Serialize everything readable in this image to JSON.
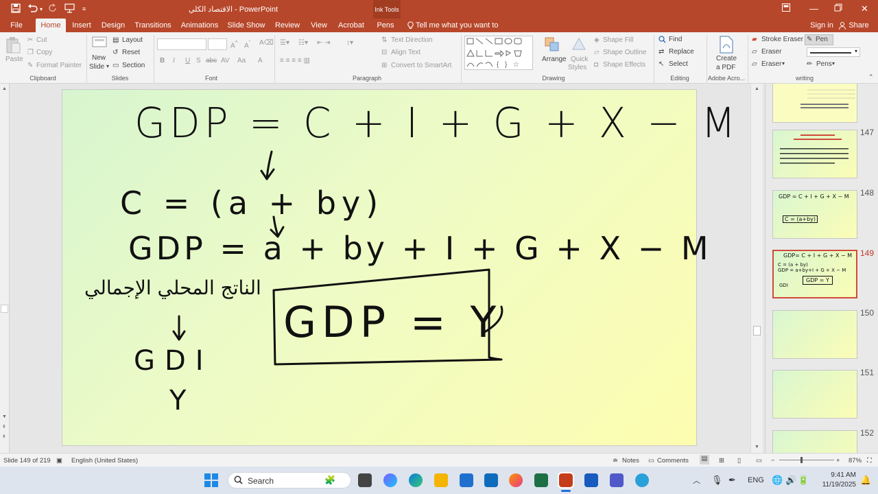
{
  "titlebar": {
    "title": "الاقتصاد الكلي - PowerPoint",
    "context_tab": "Ink Tools"
  },
  "tabs": [
    "File",
    "Home",
    "Insert",
    "Design",
    "Transitions",
    "Animations",
    "Slide Show",
    "Review",
    "View",
    "Acrobat",
    "Pens"
  ],
  "tell_me": "Tell me what you want to do...",
  "account": {
    "signin": "Sign in",
    "share": "Share"
  },
  "ribbon": {
    "clipboard": {
      "paste": "Paste",
      "cut": "Cut",
      "copy": "Copy",
      "format_painter": "Format Painter",
      "label": "Clipboard"
    },
    "slides": {
      "new_slide_1": "New",
      "new_slide_2": "Slide",
      "layout": "Layout",
      "reset": "Reset",
      "section": "Section",
      "label": "Slides"
    },
    "font": {
      "label": "Font",
      "bold": "B",
      "italic": "I",
      "underline": "U",
      "strike": "S",
      "abc": "abc",
      "av": "AV",
      "aa": "Aa",
      "a": "A"
    },
    "paragraph": {
      "text_direction": "Text Direction",
      "align_text": "Align Text",
      "convert_smartart": "Convert to SmartArt",
      "label": "Paragraph"
    },
    "drawing": {
      "arrange": "Arrange",
      "quick_styles_1": "Quick",
      "quick_styles_2": "Styles",
      "shape_fill": "Shape Fill",
      "shape_outline": "Shape Outline",
      "shape_effects": "Shape Effects",
      "label": "Drawing"
    },
    "editing": {
      "find": "Find",
      "replace": "Replace",
      "select": "Select",
      "label": "Editing"
    },
    "acrobat": {
      "create_pdf_1": "Create",
      "create_pdf_2": "a PDF",
      "label": "Adobe Acro..."
    },
    "writing": {
      "stroke_eraser": "Stroke Eraser",
      "eraser": "Eraser",
      "eraser2": "Eraser",
      "pen": "Pen",
      "pens": "Pens",
      "label": "writing"
    }
  },
  "slide_content": {
    "eq1": "GDP = C + I + G + X − M",
    "eq2": "C = (a + by)",
    "eq3": "GDP = a + by + I + G + X − M",
    "arabic_note": "الناتج المحلي الإجمالي",
    "eq4": "GDI",
    "eq4b": "Y",
    "boxed": "GDP = Y"
  },
  "thumbnails": [
    {
      "num": "",
      "active": false
    },
    {
      "num": "147",
      "active": false
    },
    {
      "num": "148",
      "active": false
    },
    {
      "num": "149",
      "active": true
    },
    {
      "num": "150",
      "active": false
    },
    {
      "num": "151",
      "active": false
    },
    {
      "num": "152",
      "active": false
    }
  ],
  "thumb_text": {
    "t148a": "GDP = C + I + G + X − M",
    "t148b": "C = (a+by)",
    "t149a": "GDP= C + I + G + X − M",
    "t149b": "C = (a + by)",
    "t149c": "GDP = a+by+I + G + X − M",
    "t149d": "GDI",
    "t149e": "GDP = Y"
  },
  "status": {
    "slide_info": "Slide 149 of 219",
    "language": "English (United States)",
    "notes": "Notes",
    "comments": "Comments",
    "zoom": "87%"
  },
  "taskbar": {
    "search": "Search",
    "lang": "ENG",
    "time": "9:41 AM",
    "date": "11/19/2025"
  },
  "colors": {
    "accent": "#b7472a",
    "slide_active_border": "#d14a3a"
  }
}
